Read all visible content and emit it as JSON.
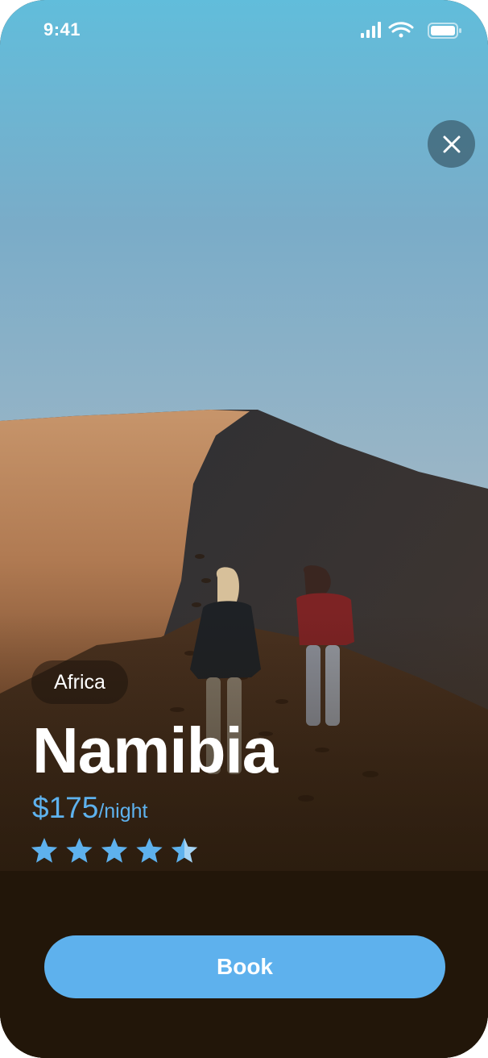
{
  "status_bar": {
    "time": "9:41",
    "icons": [
      "cellular-signal-icon",
      "wifi-icon",
      "battery-icon"
    ]
  },
  "hero": {
    "scene": "desert-dune-photo",
    "icon": "close-icon"
  },
  "destination": {
    "region": "Africa",
    "name": "Namibia",
    "price": "$175",
    "price_unit": "/night",
    "rating": 4.5,
    "rating_max": 5
  },
  "actions": {
    "book_label": "Book"
  },
  "colors": {
    "accent": "#5eb1ed",
    "text": "#ffffff",
    "footer_background": "#221609"
  }
}
